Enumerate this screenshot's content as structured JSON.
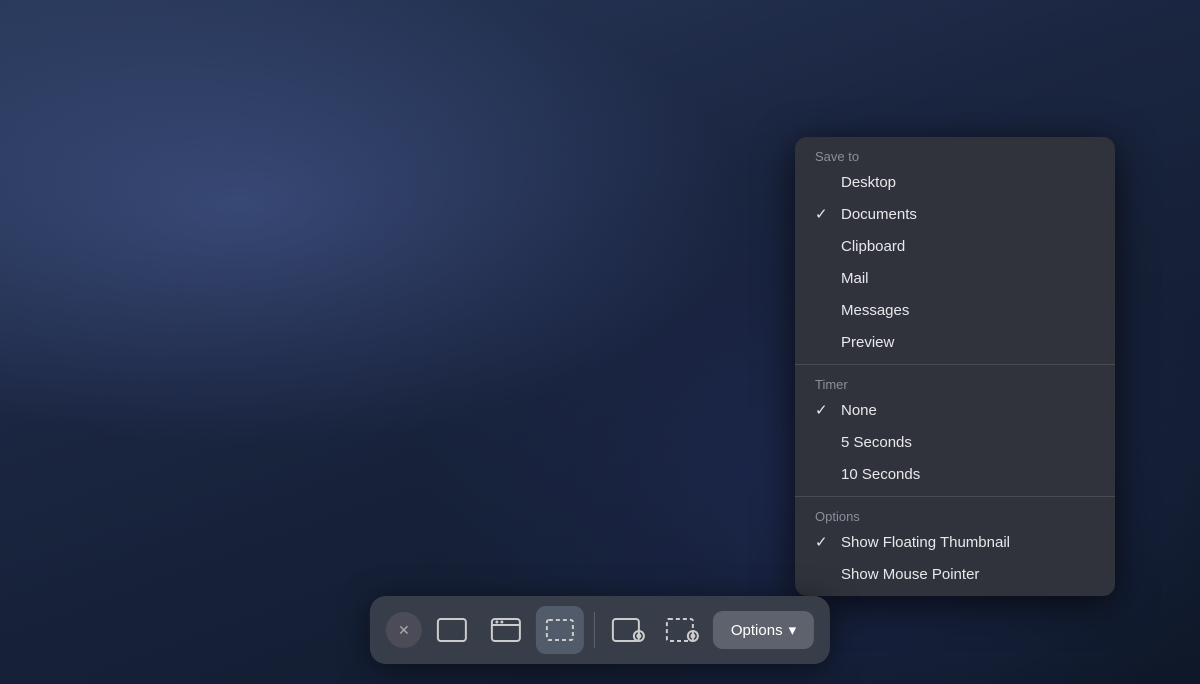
{
  "desktop": {
    "background": "macOS dark desktop"
  },
  "dropdown": {
    "sections": [
      {
        "id": "save-to",
        "label": "Save to",
        "items": [
          {
            "id": "desktop",
            "label": "Desktop",
            "checked": false
          },
          {
            "id": "documents",
            "label": "Documents",
            "checked": true
          },
          {
            "id": "clipboard",
            "label": "Clipboard",
            "checked": false
          },
          {
            "id": "mail",
            "label": "Mail",
            "checked": false
          },
          {
            "id": "messages",
            "label": "Messages",
            "checked": false
          },
          {
            "id": "preview",
            "label": "Preview",
            "checked": false
          }
        ]
      },
      {
        "id": "timer",
        "label": "Timer",
        "items": [
          {
            "id": "none",
            "label": "None",
            "checked": true
          },
          {
            "id": "5-seconds",
            "label": "5 Seconds",
            "checked": false
          },
          {
            "id": "10-seconds",
            "label": "10 Seconds",
            "checked": false
          }
        ]
      },
      {
        "id": "options",
        "label": "Options",
        "items": [
          {
            "id": "show-floating-thumbnail",
            "label": "Show Floating Thumbnail",
            "checked": true
          },
          {
            "id": "show-mouse-pointer",
            "label": "Show Mouse Pointer",
            "checked": false
          }
        ]
      }
    ]
  },
  "toolbar": {
    "options_label": "Options",
    "options_chevron": "▾",
    "buttons": [
      {
        "id": "close",
        "label": "✕"
      },
      {
        "id": "full-screen-capture",
        "label": ""
      },
      {
        "id": "window-capture",
        "label": ""
      },
      {
        "id": "selection-capture",
        "label": "",
        "active": true
      },
      {
        "id": "screen-record-full",
        "label": ""
      },
      {
        "id": "screen-record-selection",
        "label": ""
      }
    ]
  }
}
